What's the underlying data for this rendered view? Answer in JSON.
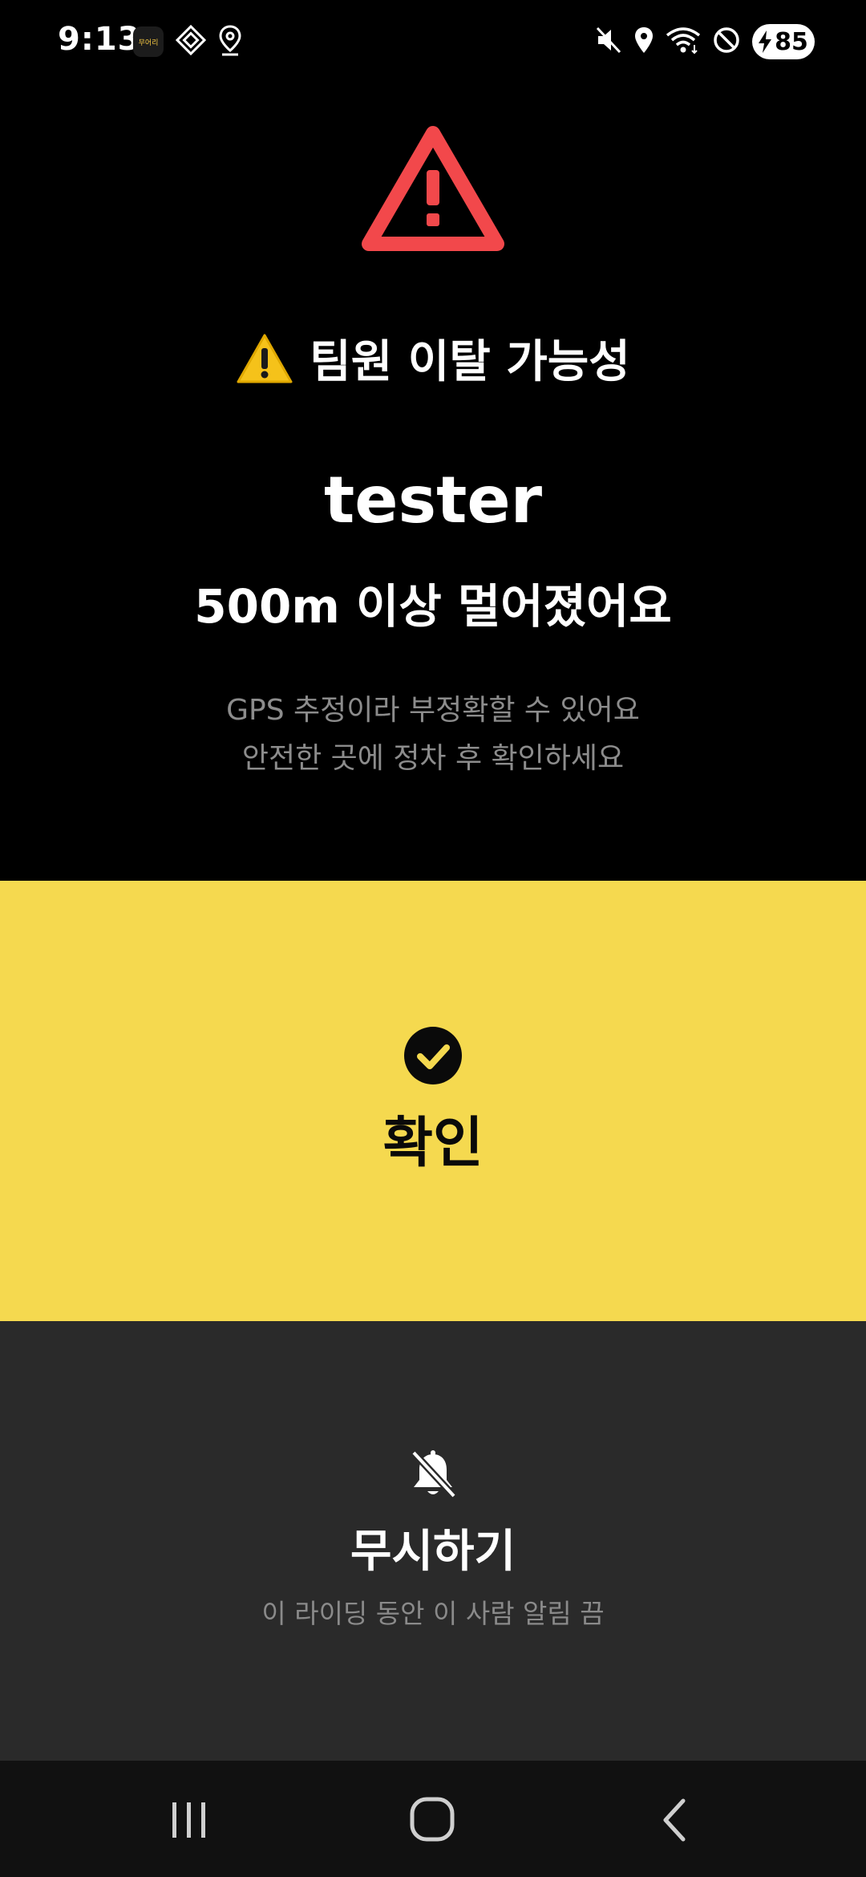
{
  "status_bar": {
    "time": "9:13",
    "app_badge_text": "무어리",
    "battery_level": "85",
    "left_icons": [
      "app-badge",
      "nearby-share-icon",
      "location-pin-icon"
    ],
    "right_icons": [
      "mute-icon",
      "location-icon",
      "wifi-icon",
      "do-not-disturb-icon",
      "charging-battery-icon"
    ]
  },
  "alert": {
    "icon": "warning-triangle-icon",
    "icon_color": "#f2484b",
    "title_emoji_icon": "warning-emoji-icon",
    "title": "팀원 이탈 가능성",
    "name": "tester",
    "distance_message": "500m 이상 멀어졌어요",
    "note_line1": "GPS 추정이라 부정확할 수 있어요",
    "note_line2": "안전한 곳에 정차 후 확인하세요"
  },
  "confirm": {
    "icon": "check-circle-icon",
    "label": "확인",
    "background": "#f5d94f"
  },
  "ignore": {
    "icon": "bell-off-icon",
    "label": "무시하기",
    "sublabel": "이 라이딩 동안 이 사람 알림 끔",
    "background": "#2a2a2a"
  },
  "nav": {
    "items": [
      "recents-icon",
      "home-icon",
      "back-icon"
    ]
  }
}
